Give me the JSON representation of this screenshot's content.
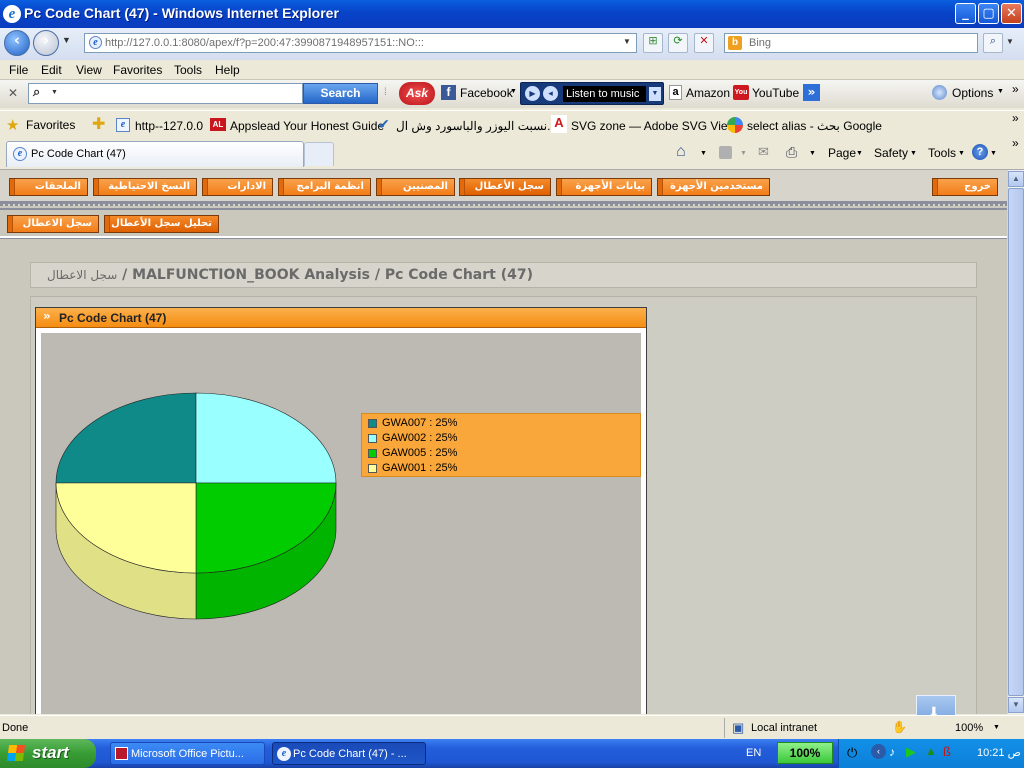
{
  "window": {
    "title": "Pc Code Chart (47) - Windows Internet Explorer",
    "buttons": {
      "minimize": "_",
      "maximize": "▢",
      "close": "✕"
    }
  },
  "address_bar": {
    "url": "http://127.0.0.1:8080/apex/f?p=200:47:3990871948957151::NO:::",
    "search_placeholder": "Bing"
  },
  "menu": [
    "File",
    "Edit",
    "View",
    "Favorites",
    "Tools",
    "Help"
  ],
  "toolbar": {
    "search_button": "Search",
    "ask": "Ask",
    "facebook": "Facebook",
    "listen": "Listen to music",
    "amazon": "Amazon",
    "youtube": "YouTube",
    "more": "»",
    "options": "Options"
  },
  "favorites_bar": {
    "label": "Favorites",
    "items": [
      "http--127.0.0",
      "Appslead  Your Honest Guide",
      "نسبت اليوزر والباسورد وش ال...",
      "SVG zone — Adobe SVG Vie...",
      "select alias - بحث Google"
    ]
  },
  "tab": {
    "label": "Pc Code Chart (47)"
  },
  "command_bar": {
    "page": "Page",
    "safety": "Safety",
    "tools": "Tools"
  },
  "app_nav": {
    "tabs": [
      "الملحقات",
      "النسخ الاحتياطية",
      "الادارات",
      "انظمة البرامج",
      "المصنيين",
      "سجل الأعطال",
      "بيانات الأجهزة",
      "مستخدمين الأجهزة"
    ],
    "logout": "خروج",
    "subtabs": [
      "سجل الاعطال",
      "تحليل سجل الأعطال"
    ]
  },
  "breadcrumb": {
    "root": "سجل الاعطال",
    "sep1": " / ",
    "middle": "MALFUNCTION_BOOK Analysis",
    "sep2": " / ",
    "current": "Pc Code Chart (47)"
  },
  "region": {
    "title": "Pc Code Chart (47)",
    "chevron": "»"
  },
  "chart_data": {
    "type": "pie",
    "slices": [
      {
        "label": "GWA007",
        "value": 25,
        "color": "#0f8a88"
      },
      {
        "label": "GAW002",
        "value": 25,
        "color": "#99ffff"
      },
      {
        "label": "GAW005",
        "value": 25,
        "color": "#00cc00"
      },
      {
        "label": "GAW001",
        "value": 25,
        "color": "#ffff99"
      }
    ],
    "legend_labels": [
      "GWA007 : 25%",
      "GAW002 : 25%",
      "GAW005 : 25%",
      "GAW001 : 25%"
    ],
    "legend_position": "right"
  },
  "status": {
    "text": "Done",
    "zone": "Local intranet",
    "zoom": "100%"
  },
  "taskbar": {
    "start": "start",
    "items": [
      "Microsoft Office Pictu...",
      "Pc Code Chart (47) - ..."
    ],
    "lang": "EN",
    "battery": "100%",
    "clock": "ص 10:21"
  },
  "colors": {
    "accent_orange": "#f58d12",
    "content_bg": "#cac8bd",
    "xp_blue": "#245edb"
  }
}
